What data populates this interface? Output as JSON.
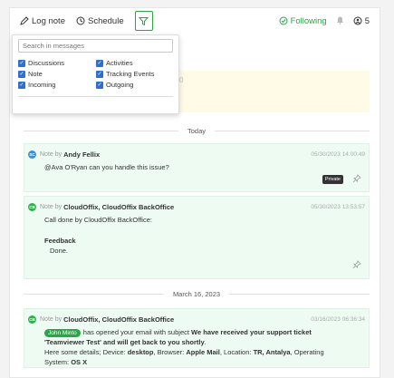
{
  "toolbar": {
    "log_note": "Log note",
    "schedule": "Schedule",
    "following": "Following",
    "followers_count": "5"
  },
  "filter": {
    "search_placeholder": "Search in messages",
    "options": [
      {
        "label": "Discussions",
        "checked": true
      },
      {
        "label": "Activities",
        "checked": true
      },
      {
        "label": "Note",
        "checked": true
      },
      {
        "label": "Tracking Events",
        "checked": true
      },
      {
        "label": "Incoming",
        "checked": true
      },
      {
        "label": "Outgoing",
        "checked": true
      }
    ]
  },
  "yellow_fragment": "0",
  "separators": {
    "today": "Today",
    "march": "March 16, 2023"
  },
  "notes": [
    {
      "avatar": "SC",
      "avatar_color": "#3f8fd2",
      "note_by": "Note by",
      "author": "Andy Fellix",
      "timestamp": "05/30/2023 14:00:49",
      "body": "@Ava O'Ryan can you handle this issue?",
      "private": "Private"
    },
    {
      "avatar": "CB",
      "avatar_color": "#2cb34a",
      "note_by": "Note by",
      "author": "CloudOffix, CloudOffix BackOffice",
      "timestamp": "05/30/2023 13:53:57",
      "body_line1": "Call done by CloudOffix BackOffice:",
      "feedback_title": "Feedback",
      "feedback_value": "Done."
    },
    {
      "avatar": "CB",
      "avatar_color": "#2cb34a",
      "note_by": "Note by",
      "author": "CloudOffix, CloudOffix BackOffice",
      "timestamp": "03/16/2023 06:36:34",
      "tag": "John Minto",
      "text_a": "has opened your email with subject",
      "text_b": "We have received your support ticket 'Teamviewer Test' and will get back to you shortly",
      "text_c": ".",
      "details_label": "Here some details; Device:",
      "device": "desktop",
      "browser_label": ", Browser:",
      "browser": "Apple Mail",
      "location_label": ", Location:",
      "location": "TR, Antalya",
      "os_label": ", Operating System:",
      "os": "OS X"
    }
  ],
  "colors": {
    "accent": "#28a745",
    "checkbox": "#2f6fd0",
    "note_bg": "#eefbf3",
    "yellow_bg": "#fffbe6"
  }
}
